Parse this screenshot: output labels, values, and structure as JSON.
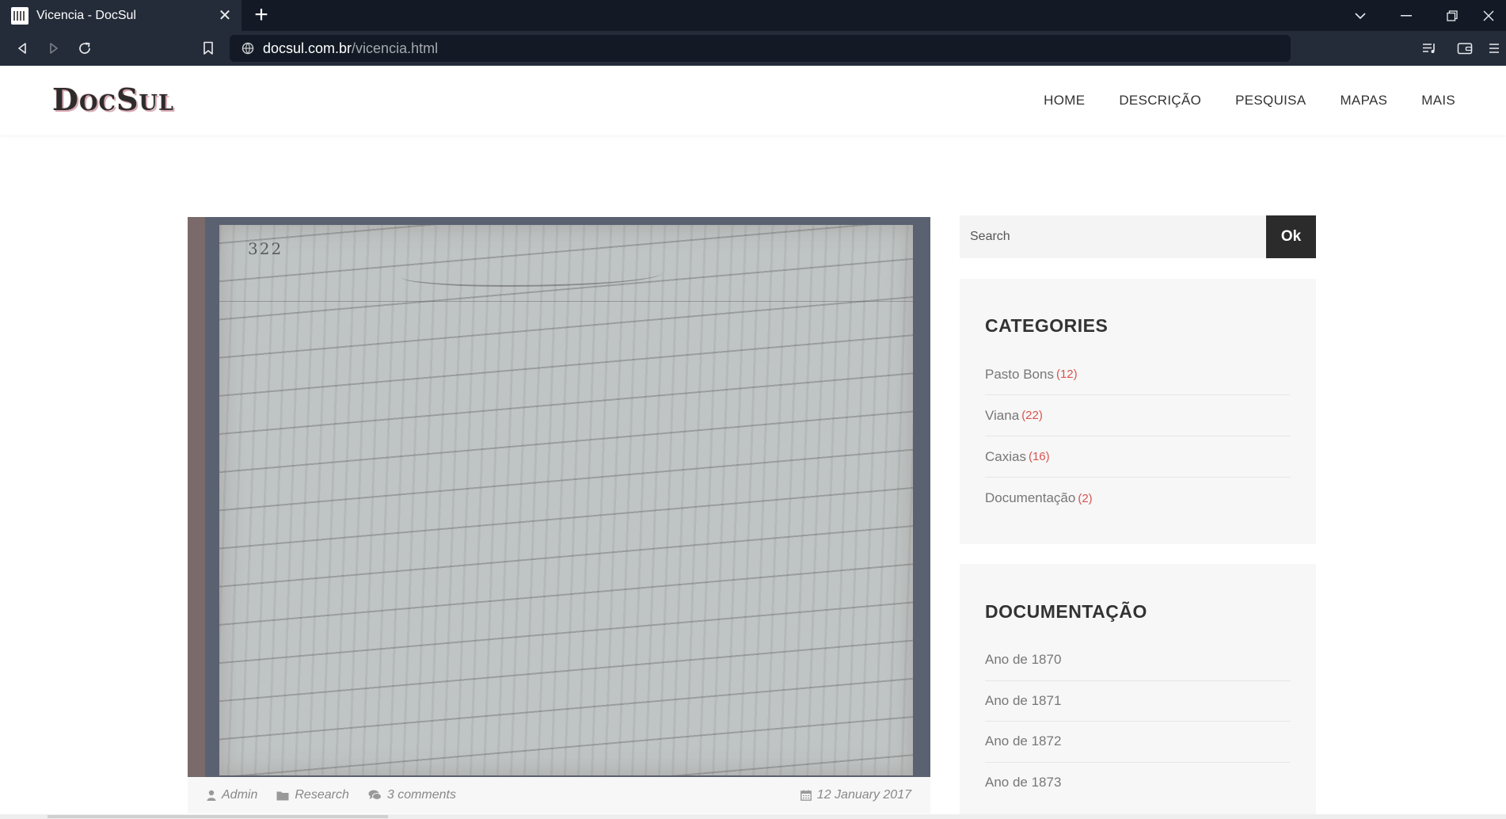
{
  "browser": {
    "tab": {
      "title": "Vicencia - DocSul",
      "favicon": "site-favicon"
    },
    "new_tab_label": "+",
    "url": {
      "host": "docsul.com.br",
      "path": "/vicencia.html"
    },
    "icons": [
      "back-icon",
      "forward-icon",
      "reload-icon",
      "bookmark-icon",
      "site-info-icon",
      "tab-search-icon",
      "minimize-icon",
      "restore-icon",
      "close-icon",
      "playlist-icon",
      "wallet-icon",
      "menu-icon"
    ]
  },
  "site": {
    "logo": "DocSul",
    "nav": [
      "HOME",
      "DESCRIÇÃO",
      "PESQUISA",
      "MAPAS",
      "MAIS"
    ]
  },
  "post": {
    "image_page_number": "322",
    "author": "Admin",
    "category": "Research",
    "comments": "3 comments",
    "date": "12 January 2017"
  },
  "sidebar": {
    "search": {
      "placeholder": "Search",
      "button": "Ok"
    },
    "categories": {
      "title": "CATEGORIES",
      "items": [
        {
          "label": "Pasto Bons",
          "count": "(12)"
        },
        {
          "label": "Viana",
          "count": "(22)"
        },
        {
          "label": "Caxias",
          "count": "(16)"
        },
        {
          "label": "Documentação",
          "count": "(2)"
        }
      ]
    },
    "documentacao": {
      "title": "DOCUMENTAÇÃO",
      "items": [
        "Ano de 1870",
        "Ano de 1871",
        "Ano de 1872",
        "Ano de 1873"
      ]
    }
  },
  "colors": {
    "chrome_dark": "#131a25",
    "chrome_tab": "#252c39",
    "count_red": "#d9534f",
    "search_button": "#2b2b2b",
    "widget_bg": "#f7f7f7"
  }
}
